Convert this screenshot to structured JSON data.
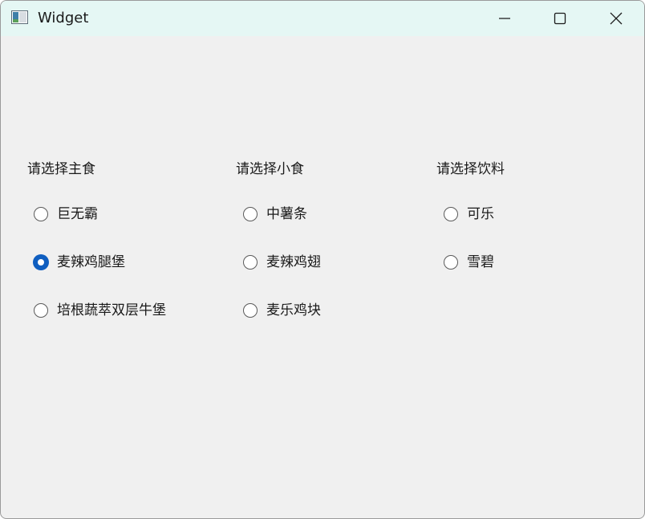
{
  "window": {
    "title": "Widget",
    "controls": {
      "minimize": "minimize-icon",
      "maximize": "maximize-icon",
      "close": "close-icon"
    }
  },
  "groups": [
    {
      "label": "请选择主食",
      "options": [
        {
          "label": "巨无霸",
          "checked": false
        },
        {
          "label": "麦辣鸡腿堡",
          "checked": true
        },
        {
          "label": "培根蔬萃双层牛堡",
          "checked": false
        }
      ]
    },
    {
      "label": "请选择小食",
      "options": [
        {
          "label": "中薯条",
          "checked": false
        },
        {
          "label": "麦辣鸡翅",
          "checked": false
        },
        {
          "label": "麦乐鸡块",
          "checked": false
        }
      ]
    },
    {
      "label": "请选择饮料",
      "options": [
        {
          "label": "可乐",
          "checked": false
        },
        {
          "label": "雪碧",
          "checked": false
        }
      ]
    }
  ],
  "colors": {
    "titlebar": "#e5f7f4",
    "client": "#f0f0f0",
    "accent": "#0f5ec0"
  }
}
